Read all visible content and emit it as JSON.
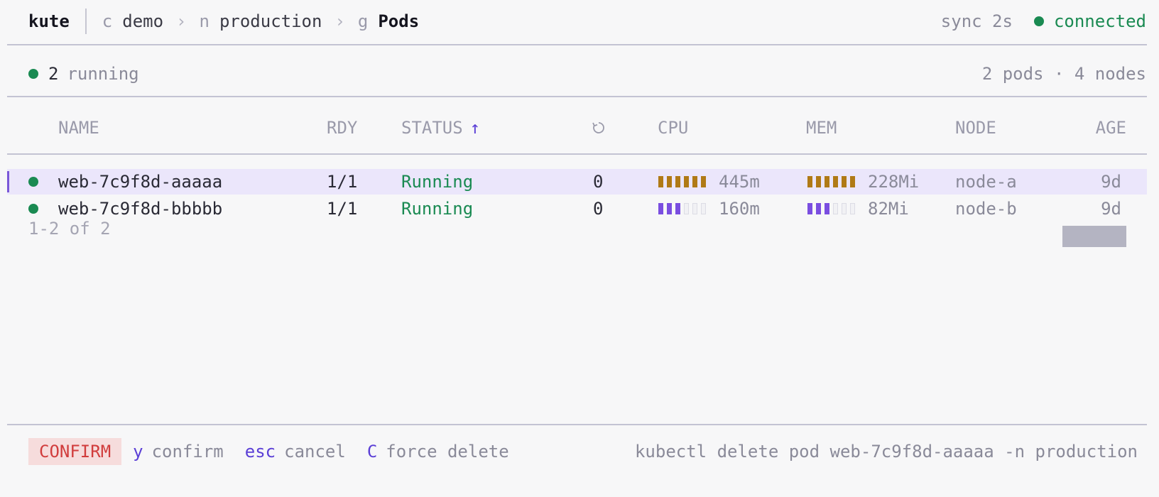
{
  "app": {
    "title": "kute"
  },
  "breadcrumb": [
    {
      "key": "c",
      "value": "demo"
    },
    {
      "key": "n",
      "value": "production"
    },
    {
      "key": "g",
      "value": "Pods"
    }
  ],
  "separator": "›",
  "status": {
    "sync": "sync 2s",
    "connection": "connected",
    "connection_color": "#1a8a52"
  },
  "summary": {
    "running_count": "2",
    "running_label": "running",
    "stats": "2 pods · 4 nodes"
  },
  "table": {
    "columns": {
      "name": "NAME",
      "ready": "RDY",
      "status": "STATUS",
      "status_sort": "↑",
      "restarts_icon": "restart-icon",
      "cpu": "CPU",
      "mem": "MEM",
      "node": "NODE",
      "age": "AGE"
    },
    "rows": [
      {
        "name": "web-7c9f8d-aaaaa",
        "ready": "1/1",
        "status": "Running",
        "restarts": "0",
        "cpu": "445m",
        "cpu_level": 6,
        "mem": "228Mi",
        "mem_level": 6,
        "node": "node-a",
        "age": "9d",
        "selected": true
      },
      {
        "name": "web-7c9f8d-bbbbb",
        "ready": "1/1",
        "status": "Running",
        "restarts": "0",
        "cpu": "160m",
        "cpu_level": 3,
        "mem": "82Mi",
        "mem_level": 3,
        "node": "node-b",
        "age": "9d",
        "selected": false
      }
    ],
    "bar_segments": 6,
    "pager": "1-2 of 2"
  },
  "footer": {
    "mode": "CONFIRM",
    "keys": [
      {
        "key": "y",
        "label": "confirm"
      },
      {
        "key": "esc",
        "label": "cancel"
      },
      {
        "key": "C",
        "label": "force delete"
      }
    ],
    "command": "kubectl delete pod web-7c9f8d-aaaaa -n production"
  },
  "colors": {
    "accent": "#5b3fd6",
    "running": "#1a8a52",
    "danger": "#d13d3d",
    "bar_high": "#b07a16",
    "bar_low": "#7a4ee0",
    "selection": "#ebe6fb"
  }
}
